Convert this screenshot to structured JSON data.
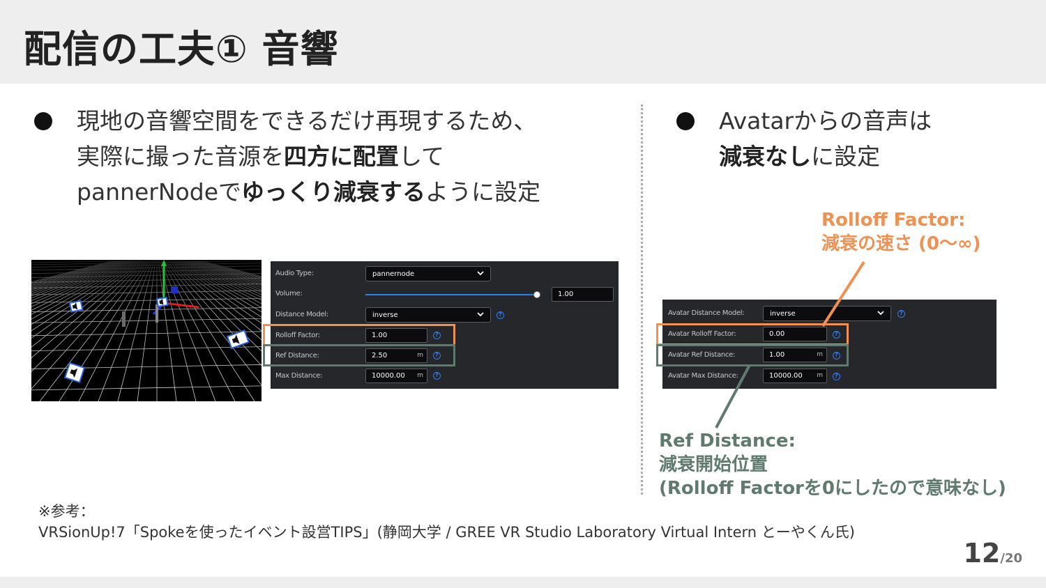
{
  "slide": {
    "title": "配信の工夫① 音響",
    "page_current": "12",
    "page_total": "/20"
  },
  "colors": {
    "accent_orange": "#ee9152",
    "accent_green": "#5f7a6e",
    "header_bg": "#eeeeee",
    "panel_bg": "#25272b",
    "help_blue": "#2f7ef6"
  },
  "left": {
    "line1": "現地の音響空間をできるだけ再現するため、",
    "line2_a": "実際に撮った音源を",
    "line2_b": "四方に配置",
    "line2_c": "して",
    "line3_a": "pannerNodeで",
    "line3_b": "ゆっくり減衰する",
    "line3_c": "ように設定"
  },
  "right": {
    "line1": "Avatarからの音声は",
    "line2_a": "減衰なし",
    "line2_b": "に設定"
  },
  "left_panel": {
    "audio_type_label": "Audio Type:",
    "audio_type_value": "pannernode",
    "volume_label": "Volume:",
    "volume_value": "1.00",
    "volume_level": 1.0,
    "distance_model_label": "Distance Model:",
    "distance_model_value": "inverse",
    "rolloff_label": "Rolloff Factor:",
    "rolloff_value": "1.00",
    "ref_label": "Ref Distance:",
    "ref_value": "2.50",
    "ref_unit": "m",
    "max_label": "Max Distance:",
    "max_value": "10000.00",
    "max_unit": "m"
  },
  "right_panel": {
    "distance_model_label": "Avatar Distance Model:",
    "distance_model_value": "inverse",
    "rolloff_label": "Avatar Rolloff Factor:",
    "rolloff_value": "0.00",
    "ref_label": "Avatar Ref Distance:",
    "ref_value": "1.00",
    "ref_unit": "m",
    "max_label": "Avatar Max Distance:",
    "max_value": "10000.00",
    "max_unit": "m"
  },
  "annotations": {
    "rolloff_line1": "Rolloff Factor:",
    "rolloff_line2": "減衰の速さ (0〜∞)",
    "ref_line1": "Ref Distance:",
    "ref_line2": "減衰開始位置",
    "ref_line3": "(Rolloff Factorを0にしたので意味なし)"
  },
  "reference": {
    "line1": "※参考：",
    "line2": "VRSionUp!7「Spokeを使ったイベント設営TIPS」(静岡大学 / GREE VR Studio Laboratory Virtual Intern とーやくん氏)"
  },
  "icons": {
    "help": "?",
    "chevron": "chevron-down-icon",
    "speaker": "speaker-icon"
  }
}
